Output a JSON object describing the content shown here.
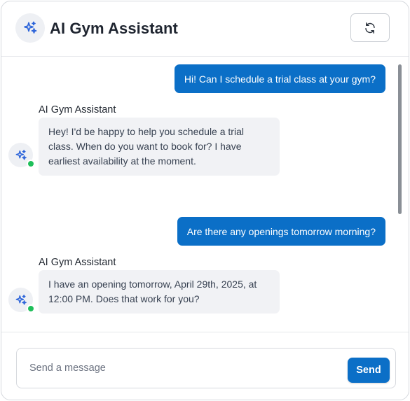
{
  "header": {
    "title": "AI Gym Assistant",
    "avatar_icon": "sparkles-icon",
    "refresh_icon": "refresh-icon"
  },
  "messages": [
    {
      "role": "user",
      "text": "Hi! Can I schedule a trial class at your gym?"
    },
    {
      "role": "assistant",
      "sender": "AI Gym Assistant",
      "text": "Hey! I'd be happy to help you schedule a trial class. When do you want to book for? I have earliest availability at the moment.",
      "status": "online"
    },
    {
      "role": "user",
      "text": "Are there any openings tomorrow morning?"
    },
    {
      "role": "assistant",
      "sender": "AI Gym Assistant",
      "text": "I have an opening tomorrow, April 29th, 2025, at 12:00 PM. Does that work for you?",
      "status": "online"
    }
  ],
  "composer": {
    "placeholder": "Send a message",
    "value": "",
    "send_label": "Send"
  },
  "colors": {
    "accent": "#0b6fc7",
    "bot_bubble": "#f1f2f5",
    "online": "#1fbf5a",
    "icon": "#2b63d9"
  }
}
